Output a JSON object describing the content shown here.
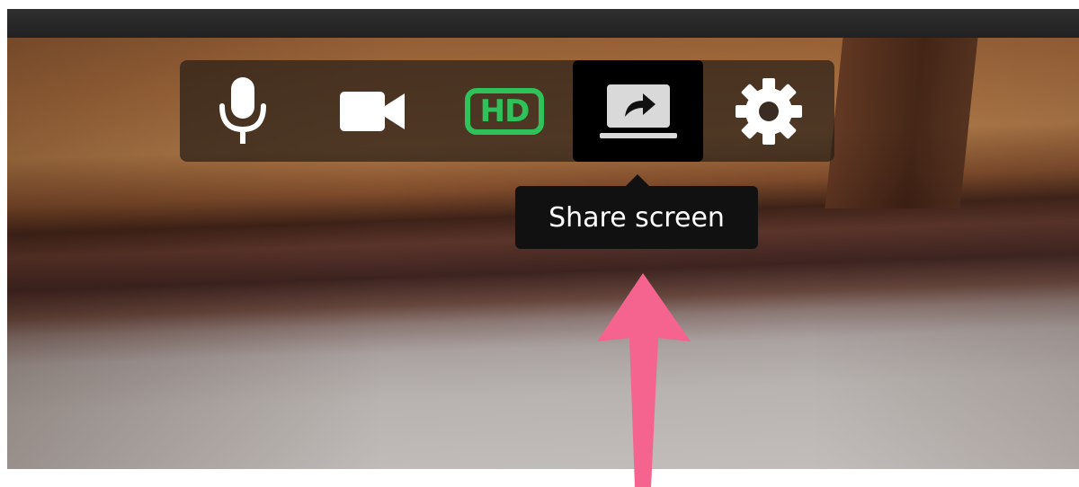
{
  "window": {
    "top_bar": ""
  },
  "toolbar": {
    "buttons": [
      {
        "id": "mic",
        "icon": "microphone-icon",
        "active": false
      },
      {
        "id": "camera",
        "icon": "video-camera-icon",
        "active": false
      },
      {
        "id": "hd",
        "icon": "hd-icon",
        "label": "HD",
        "state": "on",
        "color": "#2fc15a"
      },
      {
        "id": "share",
        "icon": "share-screen-icon",
        "active": true
      },
      {
        "id": "settings",
        "icon": "gear-icon",
        "active": false
      }
    ]
  },
  "tooltip": {
    "text": "Share screen"
  },
  "annotation": {
    "arrow_color": "#f4648f"
  }
}
